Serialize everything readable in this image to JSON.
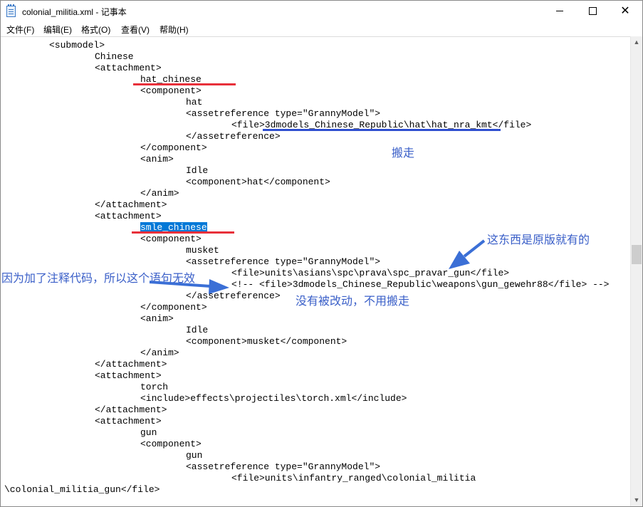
{
  "window": {
    "title": "colonial_militia.xml - 记事本",
    "icon": "notepad-icon",
    "controls": {
      "minimize": "minimize-icon",
      "maximize": "maximize-icon",
      "close_glyph": "✕"
    }
  },
  "menu": [
    {
      "label": "文件(F)"
    },
    {
      "label": "编辑(E)"
    },
    {
      "label": "格式(O)"
    },
    {
      "label": "查看(V)"
    },
    {
      "label": "帮助(H)"
    }
  ],
  "editor": {
    "lines": [
      "\t<submodel>",
      "\t\tChinese",
      "\t\t<attachment>",
      "\t\t\that_chinese",
      "\t\t\t<component>",
      "\t\t\t\that",
      "\t\t\t\t<assetreference type=\"GrannyModel\">",
      "\t\t\t\t\t<file>3dmodels_Chinese_Republic\\hat\\hat_nra_kmt</file>",
      "\t\t\t\t</assetreference>",
      "\t\t\t</component>",
      "\t\t\t<anim>",
      "\t\t\t\tIdle",
      "\t\t\t\t<component>hat</component>",
      "\t\t\t</anim>",
      "\t\t</attachment>",
      "\t\t<attachment>",
      "\t\t\tsmle_chinese",
      "\t\t\t<component>",
      "\t\t\t\tmusket",
      "\t\t\t\t<assetreference type=\"GrannyModel\">",
      "\t\t\t\t\t<file>units\\asians\\spc\\prava\\spc_pravar_gun</file>",
      "\t\t\t\t\t<!-- <file>3dmodels_Chinese_Republic\\weapons\\gun_gewehr88</file> -->",
      "\t\t\t\t</assetreference>",
      "\t\t\t</component>",
      "\t\t\t<anim>",
      "\t\t\t\tIdle",
      "\t\t\t\t<component>musket</component>",
      "\t\t\t</anim>",
      "\t\t</attachment>",
      "\t\t<attachment>",
      "\t\t\ttorch",
      "\t\t\t<include>effects\\projectiles\\torch.xml</include>",
      "\t\t</attachment>",
      "\t\t<attachment>",
      "\t\t\tgun",
      "\t\t\t<component>",
      "\t\t\t\tgun",
      "\t\t\t\t<assetreference type=\"GrannyModel\">",
      "\t\t\t\t\t<file>units\\infantry_ranged\\colonial_militia",
      "\\colonial_militia_gun</file>"
    ],
    "selected_text": "smle_chinese"
  },
  "annotations": {
    "move_away": "搬走",
    "original_has": "这东西是原版就有的",
    "comment_invalid": "因为加了注释代码，所以这个语句无效",
    "not_changed": "没有被改动，不用搬走"
  },
  "colors": {
    "annotation_text": "#3a5fc8",
    "red_underline": "#e8303a",
    "blue_underline": "#2f4fd0",
    "arrow": "#3b6fd6",
    "selection": "#0078d7"
  }
}
